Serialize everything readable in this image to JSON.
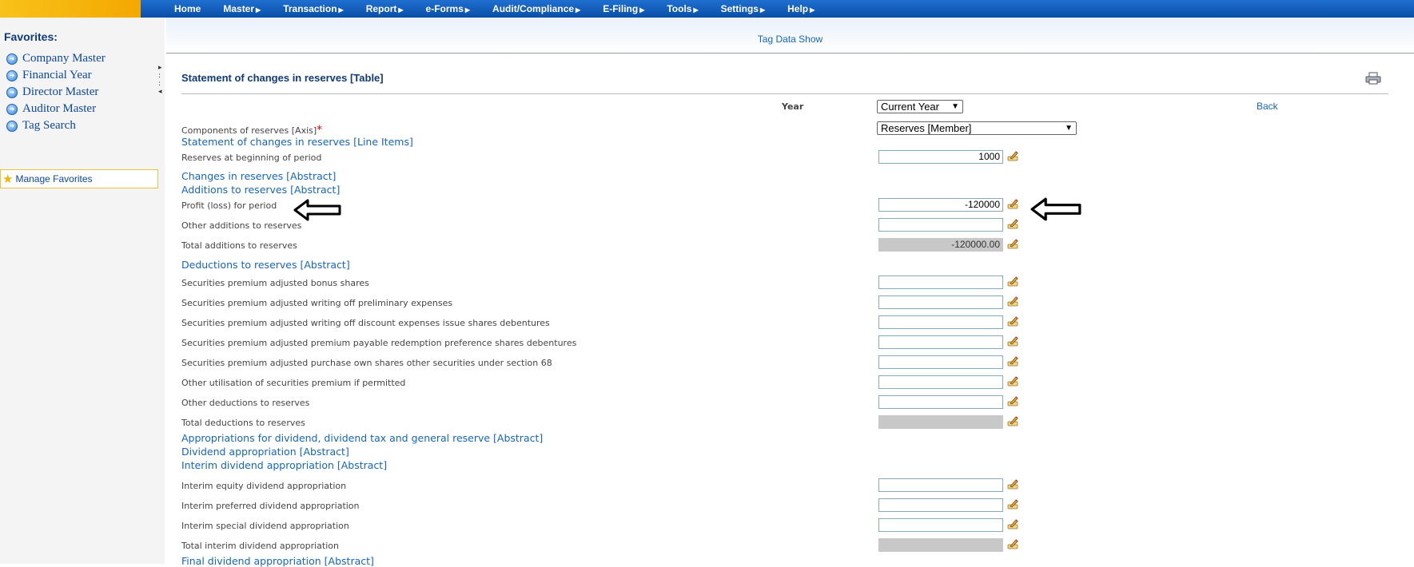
{
  "menu": [
    {
      "label": "Home",
      "arrow": false
    },
    {
      "label": "Master",
      "arrow": true
    },
    {
      "label": "Transaction",
      "arrow": true
    },
    {
      "label": "Report",
      "arrow": true
    },
    {
      "label": "e-Forms",
      "arrow": true
    },
    {
      "label": "Audit/Compliance",
      "arrow": true
    },
    {
      "label": "E-Filing",
      "arrow": true
    },
    {
      "label": "Tools",
      "arrow": true
    },
    {
      "label": "Settings",
      "arrow": true
    },
    {
      "label": "Help",
      "arrow": true
    }
  ],
  "sidebar": {
    "title": "Favorites:",
    "items": [
      "Company Master",
      "Financial Year",
      "Director Master",
      "Auditor Master",
      "Tag Search"
    ],
    "manage": "Manage Favorites"
  },
  "page": {
    "link": "Tag Data Show",
    "section_title": "Statement of changes in reserves [Table]",
    "year_label": "Year",
    "year_value": "Current Year",
    "axis_label": "Components of reserves [Axis]",
    "required_mark": "*",
    "axis_value": "Reserves [Member]",
    "back": "Back"
  },
  "rows": [
    {
      "type": "abstract",
      "label": "Statement of changes in reserves [Line Items]"
    },
    {
      "type": "field",
      "label": "Reserves at beginning of period",
      "value": "1000",
      "calc": false
    },
    {
      "type": "abstract",
      "label": "Changes in reserves [Abstract]"
    },
    {
      "type": "abstract",
      "label": "Additions to reserves [Abstract]"
    },
    {
      "type": "field",
      "label": "Profit (loss) for period",
      "value": "-120000",
      "calc": false
    },
    {
      "type": "field",
      "label": "Other additions to reserves",
      "value": "",
      "calc": false
    },
    {
      "type": "field",
      "label": "Total additions to reserves",
      "value": "-120000.00",
      "calc": true
    },
    {
      "type": "abstract",
      "label": "Deductions to reserves [Abstract]"
    },
    {
      "type": "field",
      "label": "Securities premium adjusted bonus shares",
      "value": "",
      "calc": false
    },
    {
      "type": "field",
      "label": "Securities premium adjusted writing off preliminary expenses",
      "value": "",
      "calc": false
    },
    {
      "type": "field",
      "label": "Securities premium adjusted writing off discount expenses issue shares debentures",
      "value": "",
      "calc": false
    },
    {
      "type": "field",
      "label": "Securities premium adjusted premium payable redemption preference shares debentures",
      "value": "",
      "calc": false
    },
    {
      "type": "field",
      "label": "Securities premium adjusted purchase own shares other securities under section 68",
      "value": "",
      "calc": false
    },
    {
      "type": "field",
      "label": "Other utilisation of securities premium if permitted",
      "value": "",
      "calc": false
    },
    {
      "type": "field",
      "label": "Other deductions to reserves",
      "value": "",
      "calc": false
    },
    {
      "type": "field",
      "label": "Total deductions to reserves",
      "value": "",
      "calc": true
    },
    {
      "type": "abstract",
      "label": "Appropriations for dividend, dividend tax and general reserve [Abstract]"
    },
    {
      "type": "abstract",
      "label": "Dividend appropriation [Abstract]"
    },
    {
      "type": "abstract",
      "label": "Interim dividend appropriation [Abstract]"
    },
    {
      "type": "field",
      "label": "Interim equity dividend appropriation",
      "value": "",
      "calc": false
    },
    {
      "type": "field",
      "label": "Interim preferred dividend appropriation",
      "value": "",
      "calc": false
    },
    {
      "type": "field",
      "label": "Interim special dividend appropriation",
      "value": "",
      "calc": false
    },
    {
      "type": "field",
      "label": "Total interim dividend appropriation",
      "value": "",
      "calc": true
    },
    {
      "type": "abstract",
      "label": "Final dividend appropriation [Abstract]"
    }
  ]
}
